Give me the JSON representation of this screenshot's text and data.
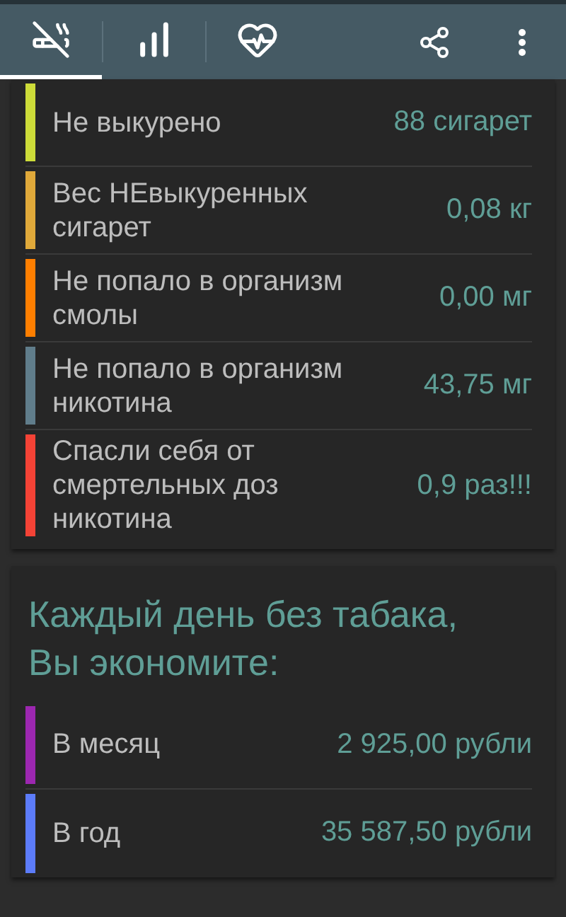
{
  "tabs": [
    {
      "kind": "no-smoking",
      "selected": true
    },
    {
      "kind": "stats",
      "selected": false
    },
    {
      "kind": "health",
      "selected": false
    }
  ],
  "actions": [
    {
      "kind": "share"
    },
    {
      "kind": "more"
    }
  ],
  "stats": [
    {
      "label": "Не выкурено",
      "value": "88 сигарет",
      "color": "#cddc39"
    },
    {
      "label": "Вес НЕвыкуренных сигарет",
      "value": "0,08 кг",
      "color": "#e0a93a"
    },
    {
      "label": "Не попало в организм смолы",
      "value": "0,00 мг",
      "color": "#ff7f00"
    },
    {
      "label": "Не попало в организм никотина",
      "value": "43,75 мг",
      "color": "#607d8b"
    },
    {
      "label": "Спасли себя от смертельных доз никотина",
      "value": "0,9 раз!!!",
      "color": "#f44336"
    }
  ],
  "savings": {
    "title": "Каждый день без табака, Вы экономите:",
    "rows": [
      {
        "label": "В месяц",
        "value": "2 925,00 рубли",
        "color": "#9c27b0"
      },
      {
        "label": "В год",
        "value": "35 587,50 рубли",
        "color": "#5c7cfa"
      }
    ]
  }
}
